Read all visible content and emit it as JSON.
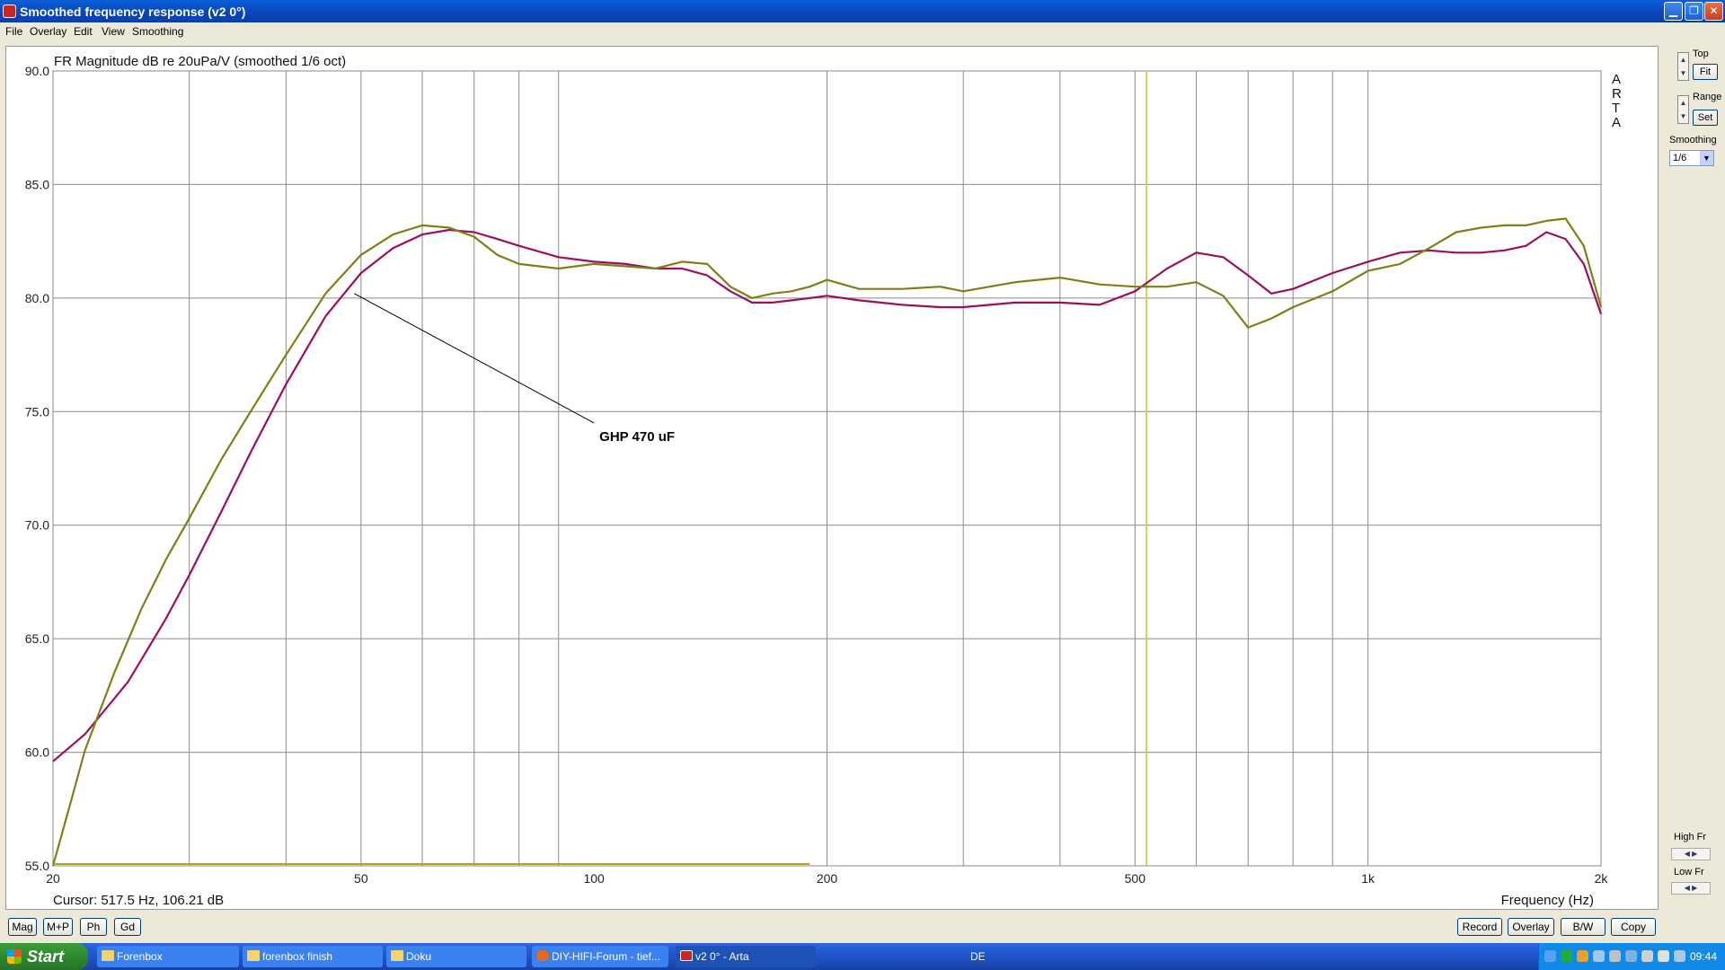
{
  "window": {
    "title": "Smoothed frequency response (v2 0°)"
  },
  "menu": [
    "File",
    "Overlay",
    "Edit",
    "View",
    "Smoothing"
  ],
  "right_panel": {
    "top_label": "Top",
    "fit_label": "Fit",
    "range_label": "Range",
    "set_label": "Set",
    "smoothing_label": "Smoothing",
    "smoothing_value": "1/6",
    "high_fr_label": "High Fr",
    "low_fr_label": "Low Fr"
  },
  "bottom_buttons": {
    "left": [
      "Mag",
      "M+P",
      "Ph",
      "Gd"
    ],
    "right": [
      "Record",
      "Overlay",
      "B/W",
      "Copy"
    ]
  },
  "taskbar": {
    "start": "Start",
    "tasks": [
      {
        "label": "Forenbox",
        "icon": "folder-icon"
      },
      {
        "label": "forenbox finish",
        "icon": "folder-icon"
      },
      {
        "label": "Doku",
        "icon": "folder-icon"
      },
      {
        "label": "DIY-HIFI-Forum - tief...",
        "icon": "firefox-icon"
      },
      {
        "label": "v2 0° - Arta",
        "icon": "arta-icon"
      }
    ],
    "language": "DE",
    "clock": "09:44"
  },
  "chart_data": {
    "type": "line",
    "title": "FR Magnitude dB re 20uPa/V (smoothed 1/6 oct)",
    "xlabel": "Frequency (Hz)",
    "ylabel": "",
    "x_scale": "log",
    "xlim": [
      20,
      2000
    ],
    "ylim": [
      55,
      90
    ],
    "x_ticks": [
      20,
      50,
      100,
      200,
      500,
      1000,
      2000
    ],
    "x_tick_labels": [
      "20",
      "50",
      "100",
      "200",
      "500",
      "1k",
      "2k"
    ],
    "y_ticks": [
      55,
      60,
      65,
      70,
      75,
      80,
      85,
      90
    ],
    "y_tick_labels": [
      "55.0",
      "60.0",
      "65.0",
      "70.0",
      "75.0",
      "80.0",
      "85.0",
      "90.0"
    ],
    "grid": true,
    "watermark": "ARTA",
    "cursor_text": "Cursor: 517.5 Hz, 106.21 dB",
    "cursor_x": 517.5,
    "annotation": {
      "text": "GHP  470 uF",
      "points_to": [
        49,
        80.2
      ],
      "text_at": [
        100,
        74.5
      ]
    },
    "series": [
      {
        "color": "#9c0f5c",
        "x": [
          20,
          22,
          25,
          28,
          30,
          33,
          36,
          40,
          45,
          50,
          55,
          60,
          65,
          70,
          75,
          80,
          90,
          100,
          110,
          120,
          130,
          140,
          150,
          160,
          170,
          180,
          190,
          200,
          220,
          250,
          280,
          300,
          350,
          400,
          450,
          500,
          550,
          600,
          650,
          700,
          750,
          800,
          900,
          1000,
          1100,
          1200,
          1300,
          1400,
          1500,
          1600,
          1700,
          1800,
          1900,
          2000
        ],
        "y": [
          59.6,
          60.8,
          63.1,
          65.9,
          67.8,
          70.6,
          73.2,
          76.2,
          79.2,
          81.1,
          82.2,
          82.8,
          83.0,
          82.9,
          82.6,
          82.3,
          81.8,
          81.6,
          81.5,
          81.3,
          81.3,
          81.0,
          80.3,
          79.8,
          79.8,
          79.9,
          80.0,
          80.1,
          79.9,
          79.7,
          79.6,
          79.6,
          79.8,
          79.8,
          79.7,
          80.3,
          81.3,
          82.0,
          81.8,
          81.0,
          80.2,
          80.4,
          81.1,
          81.6,
          82.0,
          82.1,
          82.0,
          82.0,
          82.1,
          82.3,
          82.9,
          82.6,
          81.5,
          79.3
        ]
      },
      {
        "color": "#7f7f18",
        "x": [
          20,
          21,
          22,
          24,
          26,
          28,
          30,
          33,
          36,
          40,
          45,
          50,
          55,
          60,
          65,
          70,
          75,
          80,
          90,
          100,
          110,
          120,
          130,
          140,
          150,
          160,
          170,
          180,
          190,
          200,
          220,
          250,
          280,
          300,
          350,
          400,
          450,
          500,
          550,
          600,
          650,
          700,
          750,
          800,
          900,
          1000,
          1100,
          1200,
          1300,
          1400,
          1500,
          1600,
          1700,
          1800,
          1900,
          2000
        ],
        "y": [
          55.0,
          57.6,
          60.1,
          63.5,
          66.3,
          68.5,
          70.3,
          72.9,
          75.0,
          77.5,
          80.2,
          81.9,
          82.8,
          83.2,
          83.1,
          82.7,
          81.9,
          81.5,
          81.3,
          81.5,
          81.4,
          81.3,
          81.6,
          81.5,
          80.5,
          80.0,
          80.2,
          80.3,
          80.5,
          80.8,
          80.4,
          80.4,
          80.5,
          80.3,
          80.7,
          80.9,
          80.6,
          80.5,
          80.5,
          80.7,
          80.1,
          78.7,
          79.1,
          79.6,
          80.3,
          81.2,
          81.5,
          82.2,
          82.9,
          83.1,
          83.2,
          83.2,
          83.4,
          83.5,
          82.3,
          79.6
        ]
      }
    ]
  }
}
